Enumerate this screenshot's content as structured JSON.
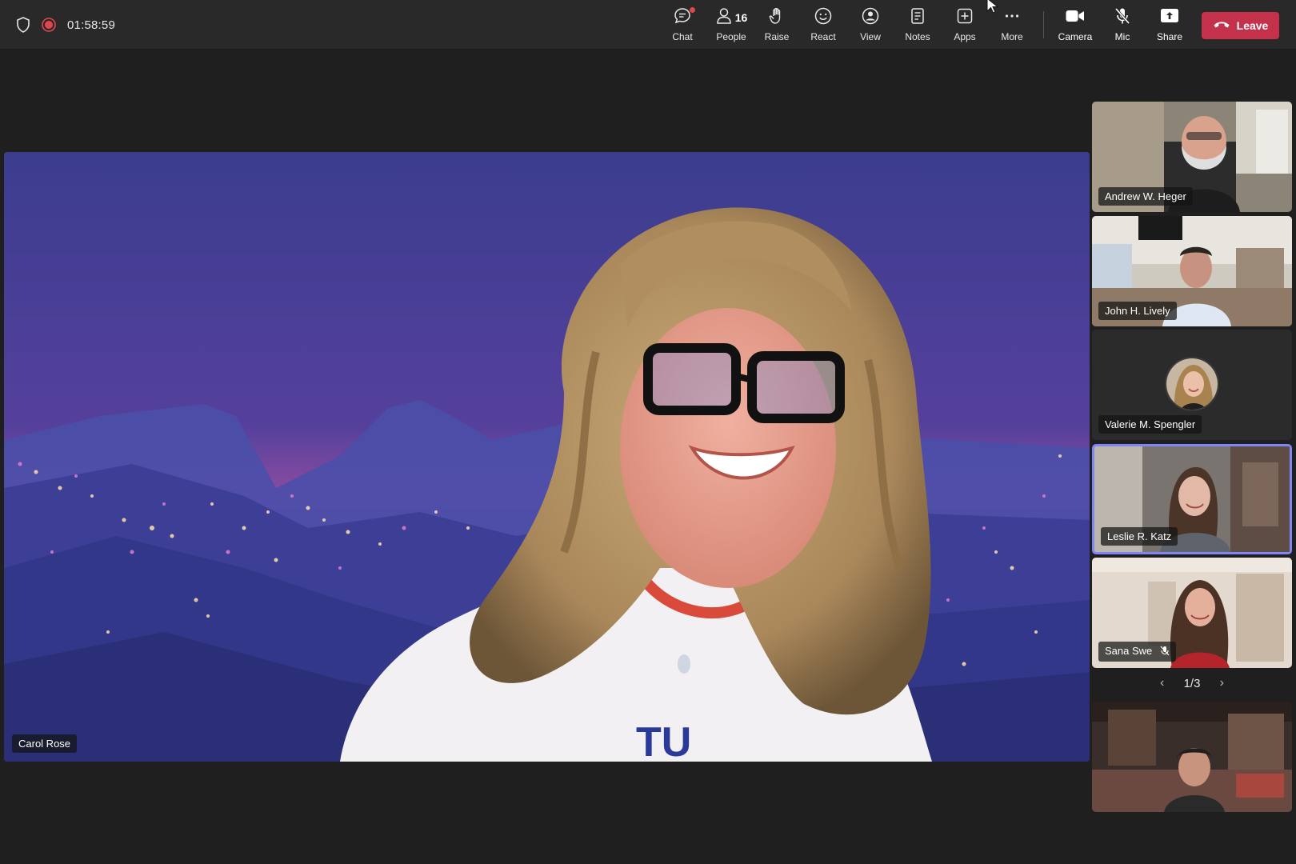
{
  "meeting": {
    "timer": "01:58:59",
    "colors": {
      "leave": "#c4314b",
      "active_tile": "#7f85f5",
      "recording": "#e0474c"
    }
  },
  "toolbar": {
    "chat_label": "Chat",
    "people_label": "People",
    "people_count": "16",
    "raise_label": "Raise",
    "react_label": "React",
    "view_label": "View",
    "notes_label": "Notes",
    "apps_label": "Apps",
    "more_label": "More",
    "camera_label": "Camera",
    "mic_label": "Mic",
    "share_label": "Share",
    "leave_label": "Leave"
  },
  "stage": {
    "main_participant": "Carol Rose"
  },
  "participants": [
    {
      "name": "Andrew W. Heger"
    },
    {
      "name": "John H. Lively"
    },
    {
      "name": "Valerie M. Spengler"
    },
    {
      "name": "Leslie R. Katz",
      "active_speaker": true
    },
    {
      "name": "Sana Swe",
      "muted": true
    }
  ],
  "pager": {
    "text": "1/3"
  }
}
